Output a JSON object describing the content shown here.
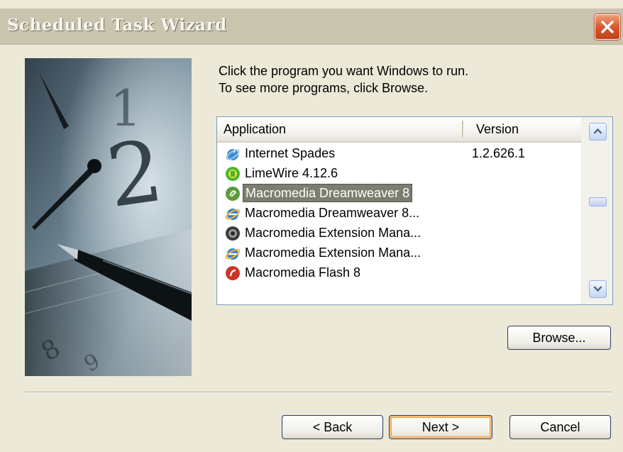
{
  "window": {
    "title": "Scheduled Task Wizard"
  },
  "instructions": {
    "line1": "Click the program you want Windows to run.",
    "line2": "To see more programs, click Browse."
  },
  "list": {
    "columns": {
      "application": "Application",
      "version": "Version"
    },
    "items": [
      {
        "name": "Internet Spades",
        "version": "1.2.626.1",
        "icon": "internet-spades-icon"
      },
      {
        "name": "LimeWire 4.12.6",
        "version": "",
        "icon": "limewire-icon"
      },
      {
        "name": "Macromedia Dreamweaver 8",
        "version": "",
        "icon": "dreamweaver-icon",
        "selected": true
      },
      {
        "name": "Macromedia Dreamweaver 8...",
        "version": "",
        "icon": "internet-explorer-icon"
      },
      {
        "name": "Macromedia Extension Mana...",
        "version": "",
        "icon": "extension-manager-icon"
      },
      {
        "name": "Macromedia Extension Mana...",
        "version": "",
        "icon": "internet-explorer-icon"
      },
      {
        "name": "Macromedia Flash 8",
        "version": "",
        "icon": "flash-icon",
        "partial": true
      }
    ]
  },
  "buttons": {
    "browse": "Browse...",
    "back": "< Back",
    "next": "Next >",
    "cancel": "Cancel"
  },
  "colors": {
    "selection": "#7d7d70",
    "title_bar": "#c8c4ae",
    "dialog_face": "#ece9d8"
  }
}
